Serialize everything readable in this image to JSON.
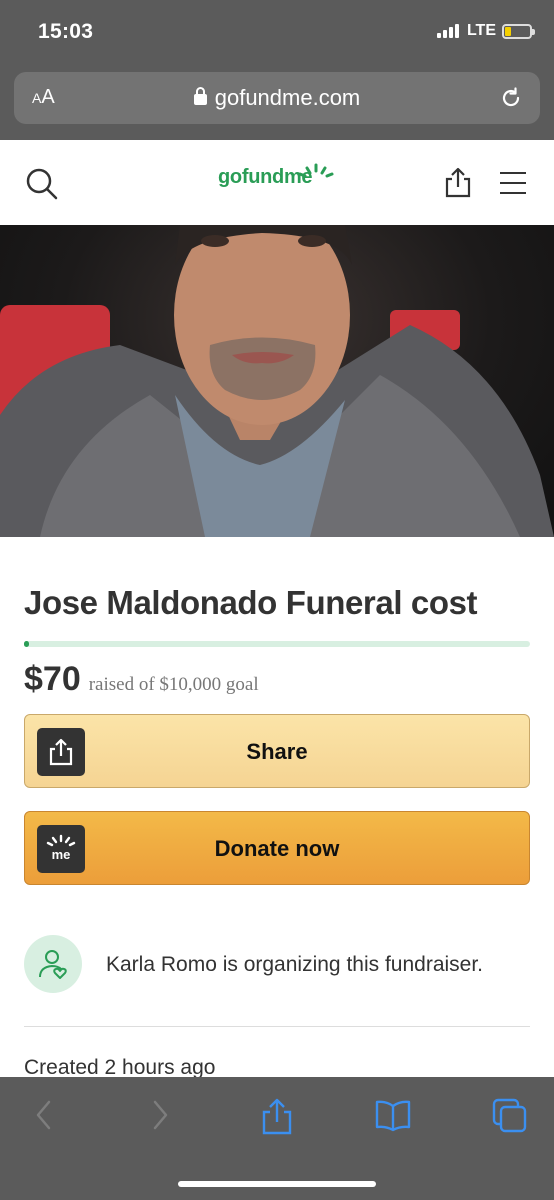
{
  "status_bar": {
    "time": "15:03",
    "network": "LTE",
    "battery_level": 0.25
  },
  "browser": {
    "reader_button": {
      "small": "A",
      "large": "A"
    },
    "url": "gofundme.com"
  },
  "site_header": {
    "logo_text": "gofundme",
    "logo_color": "#2a9d56"
  },
  "campaign": {
    "title": "Jose Maldonado Funeral cost",
    "raised_amount": "$70",
    "raised_text": "raised of $10,000 goal",
    "progress_fraction": 0.007,
    "share_label": "Share",
    "donate_label": "Donate now",
    "donate_icon_text": "me",
    "organizer_text": "Karla Romo is organizing this fundraiser.",
    "created_text": "Created 2 hours ago"
  },
  "colors": {
    "accent_green": "#2a9d56",
    "share_bg": "#f8dd9e",
    "donate_bg": "#f0ad42"
  },
  "icons": [
    "search-icon",
    "share-icon",
    "menu-icon",
    "lock-icon",
    "reload-icon",
    "back-icon",
    "forward-icon",
    "bookmarks-icon",
    "tabs-icon",
    "organizer-icon"
  ]
}
